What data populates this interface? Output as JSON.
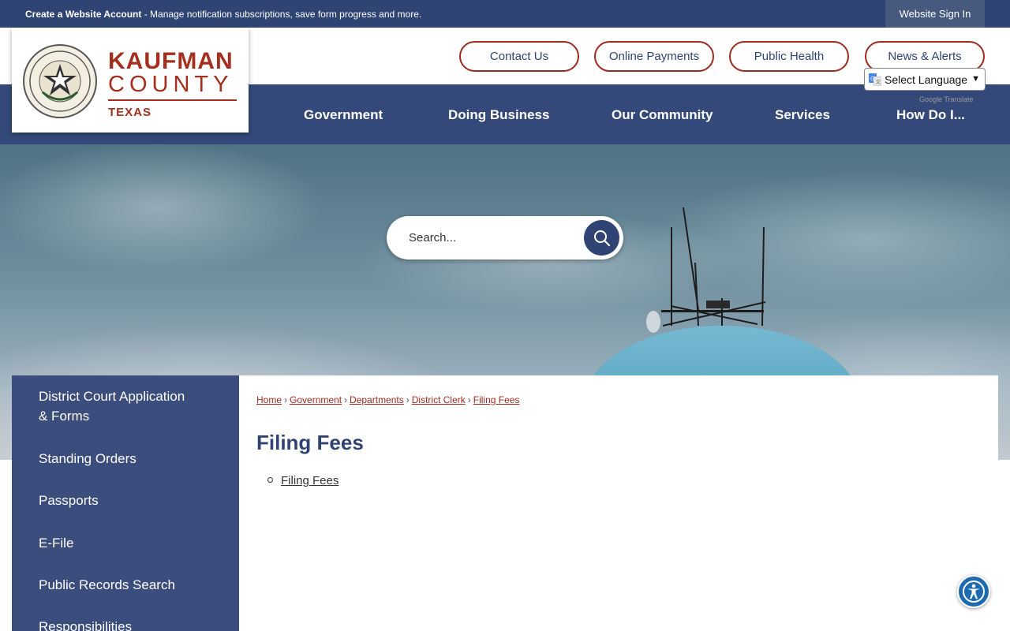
{
  "topbar": {
    "account_link": "Create a Website Account",
    "account_text": " - Manage notification subscriptions, save form progress and more.",
    "signin": "Website Sign In"
  },
  "logo": {
    "name": "KAUFMAN",
    "county": "COUNTY",
    "state": "TEXAS",
    "seal_text_top": "THE STATE OF TEXAS",
    "seal_text_bottom": "KAUFMAN COUNTY"
  },
  "quick_links": [
    "Contact Us",
    "Online Payments",
    "Public Health",
    "News & Alerts"
  ],
  "translate": {
    "select_label": "Select Language",
    "powered_prefix": "Google",
    "powered_suffix": "Translate"
  },
  "nav": [
    "Government",
    "Doing Business",
    "Our Community",
    "Services",
    "How Do I..."
  ],
  "search": {
    "placeholder": "Search..."
  },
  "sidebar": [
    "District Court Application",
    "& Forms",
    "Standing Orders",
    "Passports",
    "E-File",
    "Public Records Search",
    "Responsibilities"
  ],
  "breadcrumb": [
    "Home",
    "Government",
    "Departments",
    "District Clerk",
    "Filing Fees"
  ],
  "page": {
    "title": "Filing Fees",
    "links": [
      "Filing Fees"
    ]
  },
  "colors": {
    "navy": "#2f4473",
    "brand_red": "#a3301f",
    "accessibility_blue": "#1e6ab0"
  },
  "icons": {
    "search": "magnifier-icon",
    "accessibility": "accessibility-icon",
    "seal": "texas-star-seal",
    "google": "google-translate-icon"
  }
}
